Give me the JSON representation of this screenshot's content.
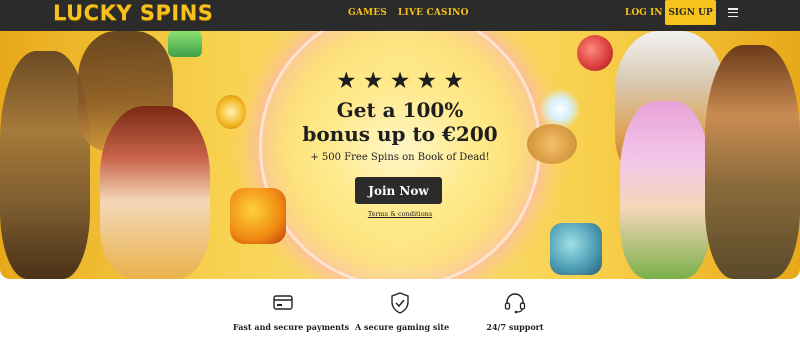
{
  "header": {
    "logo_text": "LUCKY SPINS",
    "nav": [
      {
        "label": "GAMES"
      },
      {
        "label": "LIVE CASINO"
      }
    ],
    "login_label": "LOG IN",
    "signup_label": "SIGN UP",
    "menu_icon": "hamburger-icon"
  },
  "hero": {
    "rating_stars": 5,
    "title_line1": "Get a 100%",
    "title_line2": "bonus up to €200",
    "subtitle": "+ 500 Free Spins on Book of Dead!",
    "cta_label": "Join Now",
    "terms_label": "Terms & conditions"
  },
  "features": [
    {
      "label": "Fast and secure payments",
      "icon": "credit-card-icon"
    },
    {
      "label": "A secure gaming site",
      "icon": "shield-check-icon"
    },
    {
      "label": "24/7 support",
      "icon": "headset-icon"
    }
  ],
  "colors": {
    "brand_yellow": "#f6c21b",
    "header_bg": "#2b2b2b",
    "cta_bg": "#2b2b2b"
  }
}
